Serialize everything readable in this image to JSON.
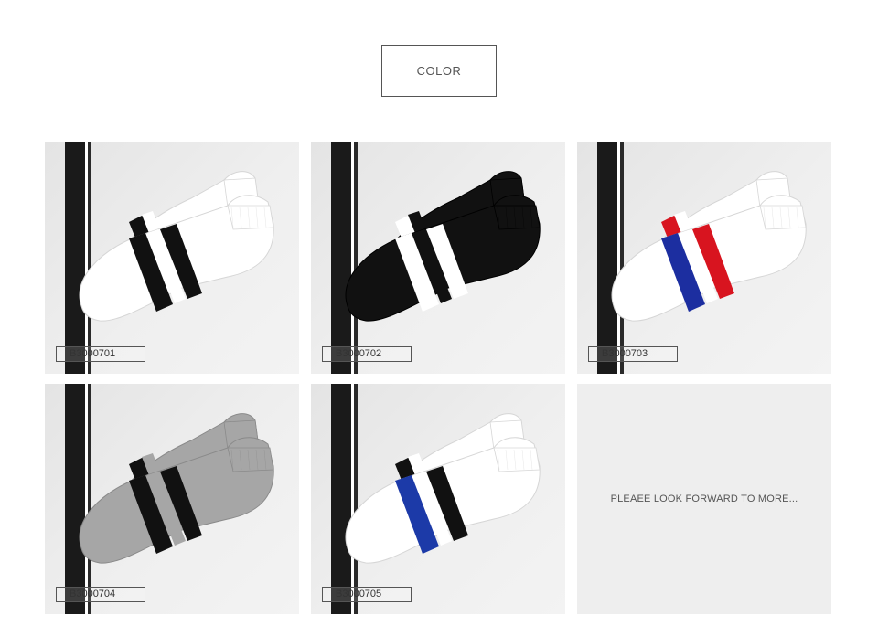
{
  "header": {
    "title": "COLOR"
  },
  "products": [
    {
      "code": "B3000701",
      "sock_color": "#ffffff",
      "stripe_colors": [
        "#111111",
        "#111111"
      ]
    },
    {
      "code": "B3000702",
      "sock_color": "#111111",
      "stripe_colors": [
        "#ffffff",
        "#ffffff"
      ]
    },
    {
      "code": "B3000703",
      "sock_color": "#ffffff",
      "stripe_colors": [
        "#d8141f",
        "#1c2ea0"
      ]
    },
    {
      "code": "B3000704",
      "sock_color": "#a6a6a6",
      "stripe_colors": [
        "#111111",
        "#111111"
      ]
    },
    {
      "code": "B3000705",
      "sock_color": "#ffffff",
      "stripe_colors": [
        "#111111",
        "#1c3aa8"
      ]
    }
  ],
  "more": {
    "text": "PLEAEE LOOK FORWARD TO MORE..."
  }
}
